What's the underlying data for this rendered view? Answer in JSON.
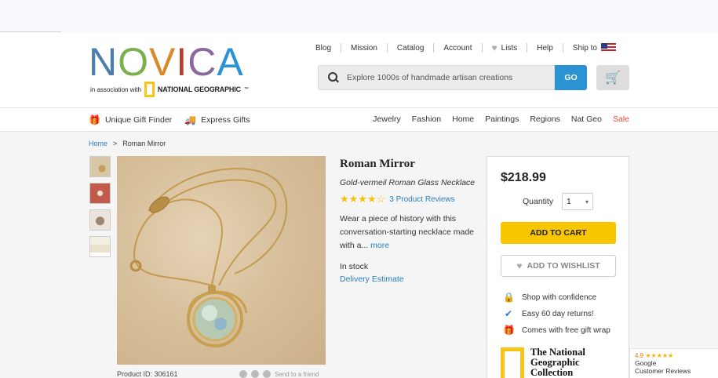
{
  "header": {
    "logo_text": "NOVICA",
    "tagline_prefix": "in association with",
    "partner": "NATIONAL GEOGRAPHIC",
    "partner_tm": "™",
    "nav": [
      {
        "label": "Blog"
      },
      {
        "label": "Mission"
      },
      {
        "label": "Catalog"
      },
      {
        "label": "Account"
      },
      {
        "label": "Lists"
      },
      {
        "label": "Help"
      },
      {
        "label": "Ship to"
      }
    ],
    "search_placeholder": "Explore 1000s of handmade artisan creations",
    "go_label": "GO"
  },
  "subnav": {
    "left": [
      {
        "label": "Unique Gift Finder"
      },
      {
        "label": "Express Gifts"
      }
    ],
    "right": [
      {
        "label": "Jewelry"
      },
      {
        "label": "Fashion"
      },
      {
        "label": "Home"
      },
      {
        "label": "Paintings"
      },
      {
        "label": "Regions"
      },
      {
        "label": "Nat Geo"
      },
      {
        "label": "Sale"
      }
    ]
  },
  "breadcrumb": {
    "home": "Home",
    "sep": ">",
    "current": "Roman Mirror"
  },
  "product": {
    "title": "Roman Mirror",
    "subtitle": "Gold-vermeil Roman Glass Necklace",
    "rating": 4,
    "rating_max": 5,
    "reviews_label": "3 Product Reviews",
    "description": "Wear a piece of history with this conversation-starting necklace made with a...",
    "more_label": "more",
    "stock": "In stock",
    "delivery": "Delivery Estimate",
    "product_id": "Product ID: 306161",
    "send_friend": "Send to a friend"
  },
  "buybox": {
    "price": "$218.99",
    "quantity_label": "Quantity",
    "quantity_value": "1",
    "add_to_cart": "ADD TO CART",
    "add_to_wishlist": "ADD TO WISHLIST",
    "features": [
      {
        "icon": "lock-icon",
        "label": "Shop with confidence"
      },
      {
        "icon": "check-icon",
        "label": "Easy 60 day returns!"
      },
      {
        "icon": "gift-icon",
        "label": "Comes with free gift wrap"
      }
    ],
    "ng_collection": "The National Geographic Collection"
  },
  "google_reviews": {
    "score": "4.9",
    "stars": "★★★★★",
    "line1": "Google",
    "line2": "Customer Reviews"
  },
  "colors": {
    "accent": "#2b93d4",
    "cart_button": "#f7c600",
    "sale": "#e04a3a",
    "ng_yellow": "#f5c518"
  }
}
